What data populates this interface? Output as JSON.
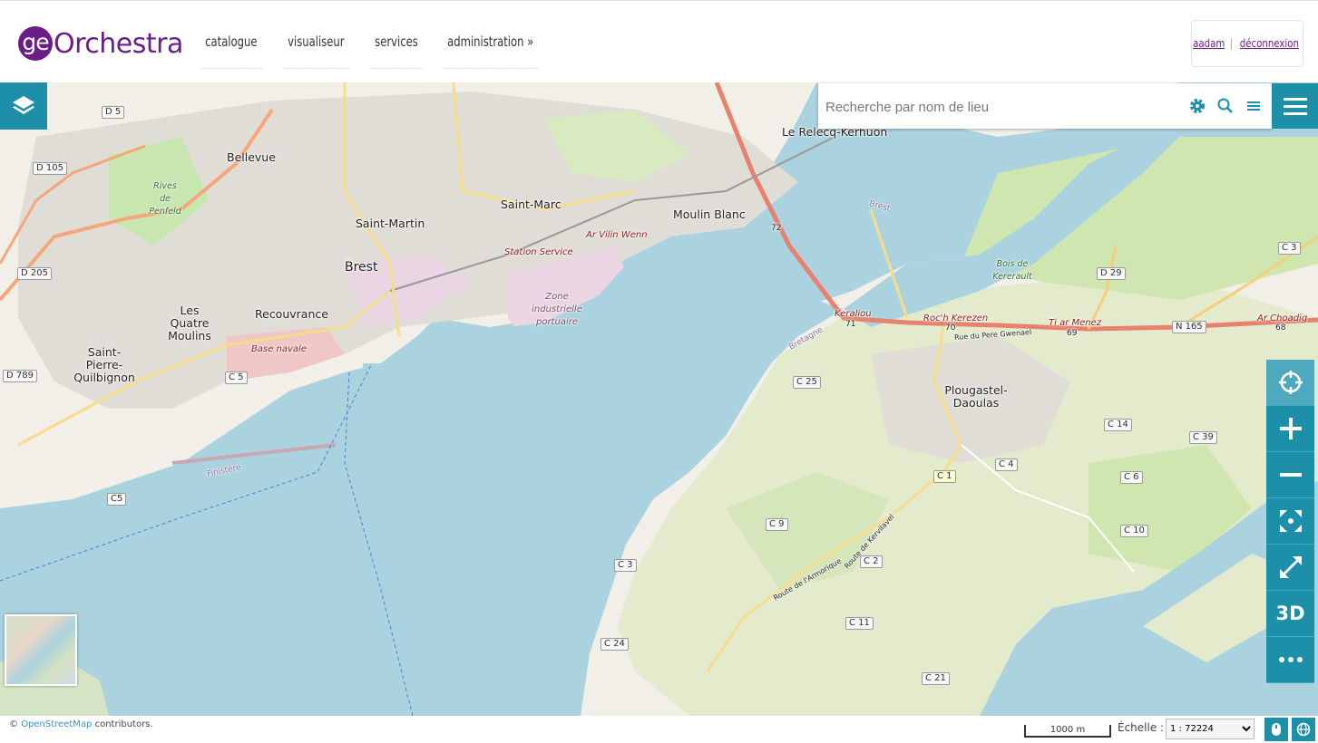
{
  "app": {
    "logo_ge": "ge",
    "logo_orchestra": "Orchestra",
    "brand_color": "#6b1d8a",
    "accent_color": "#1d8fa8"
  },
  "nav": {
    "items": [
      "catalogue",
      "visualiseur",
      "services",
      "administration »"
    ]
  },
  "user": {
    "username": "aadam",
    "separator": "|",
    "logout": "déconnexion"
  },
  "search": {
    "placeholder": "Recherche par nom de lieu",
    "icons": [
      "gear-icon",
      "search-icon",
      "list-icon"
    ]
  },
  "map": {
    "places": [
      "Bellevue",
      "Saint-Martin",
      "Saint-Marc",
      "Brest",
      "Le Relecq-Kerhuon",
      "Moulin Blanc",
      "Les Quatre Moulins",
      "Recouvrance",
      "Saint-Pierre-Quilbignon",
      "Plougastel-Daoulas"
    ],
    "italic_labels": [
      "Station Service",
      "Ar Vilin Wenn",
      "Base navale",
      "Zone industrielle portuaire"
    ],
    "green_labels": [
      "Rives de Penfeld",
      "Bois de Kererault"
    ],
    "road_shields": [
      "D 5",
      "D 105",
      "D 205",
      "D 789",
      "C 5",
      "C5",
      "C 3",
      "D 29",
      "N 165",
      "C 25",
      "C 14",
      "C 39",
      "C 1",
      "C 4",
      "C 6",
      "C 9",
      "C 10",
      "C 3",
      "C 2",
      "C 11",
      "C 24",
      "C 21"
    ],
    "road_names": [
      "Roc'h Kerezen",
      "Ti ar Menez",
      "Ar Choadig",
      "Keraliou",
      "Rue du Pere Gwenael",
      "Route de l'Armorique",
      "Route de Kervilavel",
      "Bretagne",
      "Finistère",
      "Brest"
    ],
    "km_markers": [
      "70",
      "69",
      "68",
      "71",
      "72"
    ]
  },
  "toolbar": {
    "buttons": [
      "locate-icon",
      "zoom-in-icon",
      "zoom-out-icon",
      "zoom-extent-icon",
      "fullscreen-icon",
      "3D",
      "more-icon"
    ],
    "label_3d": "3D"
  },
  "footer": {
    "attribution_prefix": "©",
    "attribution_link": "OpenStreetMap",
    "attribution_suffix": "contributors.",
    "scale_text": "1000 m",
    "scale_label": "Échelle :",
    "scale_value": "1 : 72224"
  }
}
